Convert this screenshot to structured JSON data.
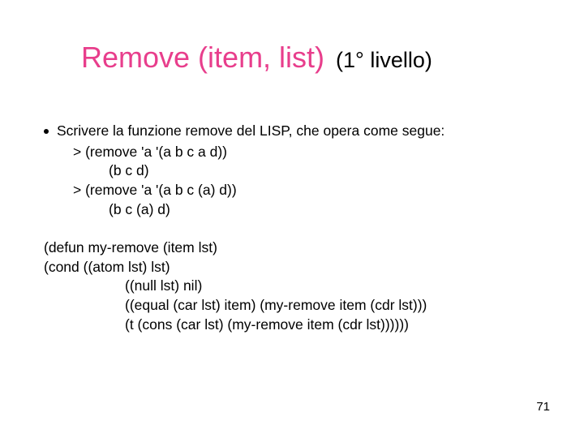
{
  "title": {
    "main": "Remove (item, list)",
    "sub": "(1° livello)"
  },
  "bullet_text": "Scrivere la funzione remove del LISP, che opera come segue:",
  "example_lines": [
    "> (remove 'a '(a b c a d))",
    "(b c d)",
    "> (remove 'a '(a b c (a) d))",
    "(b c (a) d)"
  ],
  "code_lines": [
    "(defun my-remove (item lst)",
    "(cond ((atom lst) lst)",
    "((null lst) nil)",
    "((equal (car lst) item) (my-remove item (cdr lst)))",
    "(t (cons (car lst) (my-remove item (cdr lst))))))"
  ],
  "page_number": "71"
}
